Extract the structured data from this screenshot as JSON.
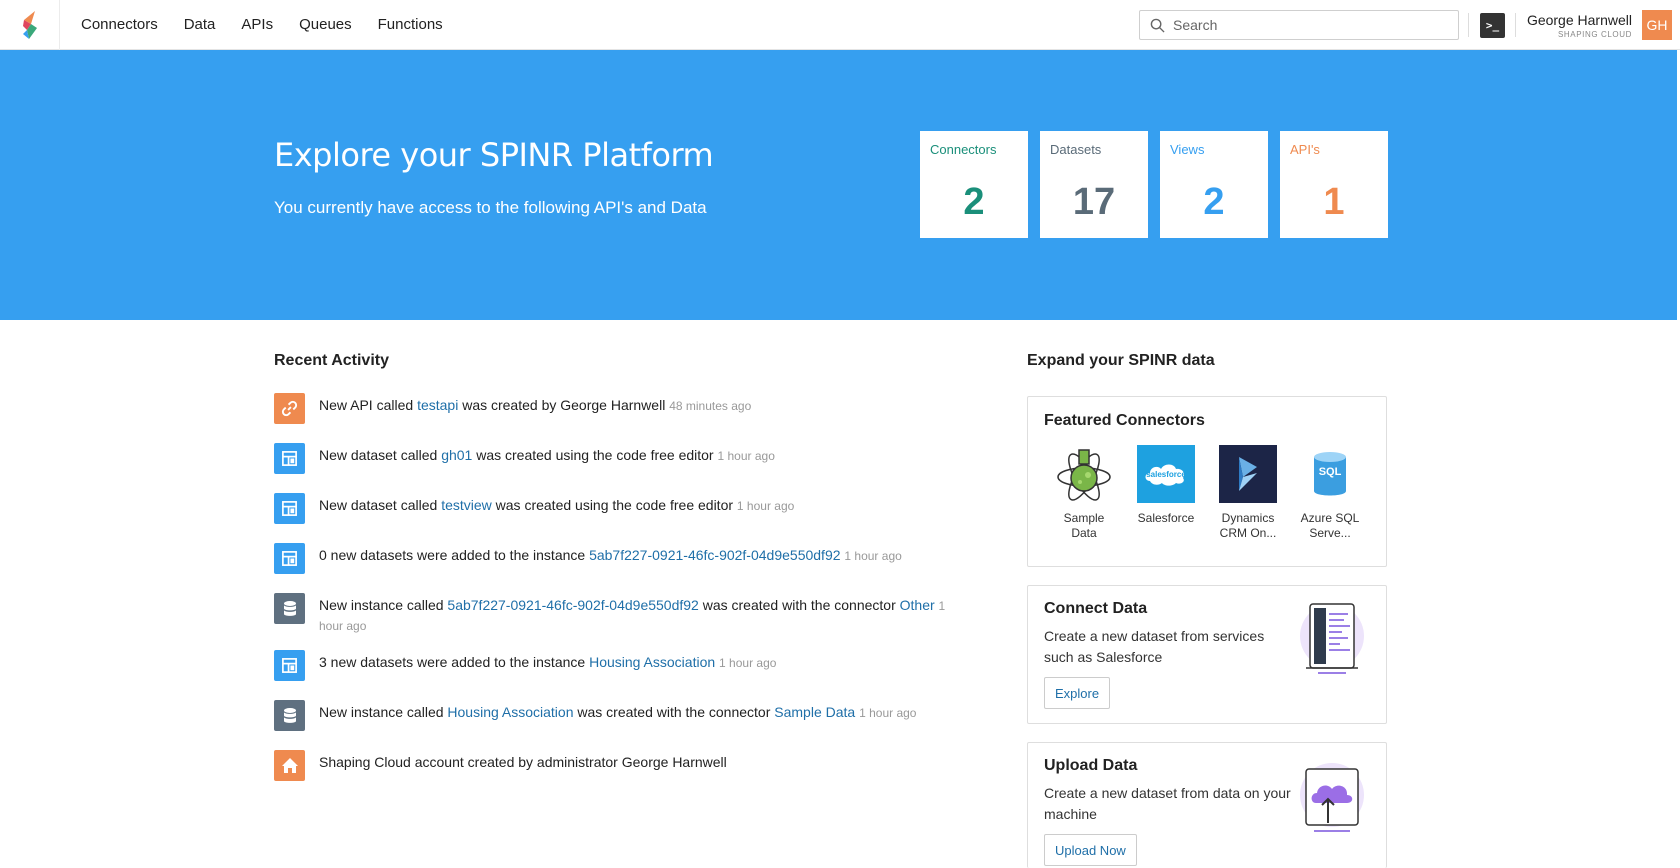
{
  "nav": {
    "items": [
      "Connectors",
      "Data",
      "APIs",
      "Queues",
      "Functions"
    ]
  },
  "search": {
    "placeholder": "Search"
  },
  "terminal_label": ">_",
  "user": {
    "name": "George Harnwell",
    "org": "SHAPING CLOUD",
    "initials": "GH"
  },
  "hero": {
    "title": "Explore your SPINR Platform",
    "subtitle": "You currently have access to the following API's and Data",
    "stats": [
      {
        "label": "Connectors",
        "value": "2",
        "color": "#1a8f7a"
      },
      {
        "label": "Datasets",
        "value": "17",
        "color": "#5a6b78"
      },
      {
        "label": "Views",
        "value": "2",
        "color": "#369ff0"
      },
      {
        "label": "API's",
        "value": "1",
        "color": "#ef8a4f"
      }
    ]
  },
  "activity": {
    "title": "Recent Activity",
    "items": [
      {
        "icon": "link-icon",
        "color": "#ef8a4f",
        "parts": [
          "New API called ",
          "testapi",
          " was created by George Harnwell ",
          "48 minutes ago"
        ]
      },
      {
        "icon": "dataset-icon",
        "color": "#369ff0",
        "parts": [
          "New dataset called ",
          "gh01",
          " was created using the code free editor ",
          "1 hour ago"
        ]
      },
      {
        "icon": "dataset-icon",
        "color": "#369ff0",
        "parts": [
          "New dataset called ",
          "testview",
          " was created using the code free editor ",
          "1 hour ago"
        ]
      },
      {
        "icon": "dataset-icon",
        "color": "#369ff0",
        "parts": [
          "0 new datasets were added to the instance ",
          "5ab7f227-0921-46fc-902f-04d9e550df92",
          " ",
          "1 hour ago"
        ]
      },
      {
        "icon": "database-icon",
        "color": "#5f7080",
        "parts": [
          "New instance called ",
          "5ab7f227-0921-46fc-902f-04d9e550df92",
          " was created with the connector ",
          "Other",
          " ",
          "1 hour ago"
        ]
      },
      {
        "icon": "dataset-icon",
        "color": "#369ff0",
        "parts": [
          "3 new datasets were added to the instance ",
          "Housing Association",
          " ",
          "1 hour ago"
        ]
      },
      {
        "icon": "database-icon",
        "color": "#5f7080",
        "parts": [
          "New instance called ",
          "Housing Association",
          " was created with the connector ",
          "Sample Data",
          " ",
          "1 hour ago"
        ]
      },
      {
        "icon": "home-icon",
        "color": "#ef8a4f",
        "parts": [
          "Shaping Cloud account created by administrator George Harnwell"
        ]
      }
    ]
  },
  "expand": {
    "title": "Expand your SPINR data",
    "featured": {
      "title": "Featured Connectors",
      "connectors": [
        {
          "name": "Sample Data",
          "line1": "Sample",
          "line2": "Data"
        },
        {
          "name": "Salesforce",
          "line1": "Salesforce",
          "line2": "",
          "logo_text": "salesforce"
        },
        {
          "name": "Dynamics CRM",
          "line1": "Dynamics",
          "line2": "CRM On..."
        },
        {
          "name": "Azure SQL",
          "line1": "Azure SQL",
          "line2": "Serve...",
          "logo_text": "SQL"
        }
      ]
    },
    "connect": {
      "title": "Connect Data",
      "desc": "Create a new dataset from services such as Salesforce",
      "button": "Explore"
    },
    "upload": {
      "title": "Upload Data",
      "desc": "Create a new dataset from data on your machine",
      "button": "Upload Now"
    }
  }
}
